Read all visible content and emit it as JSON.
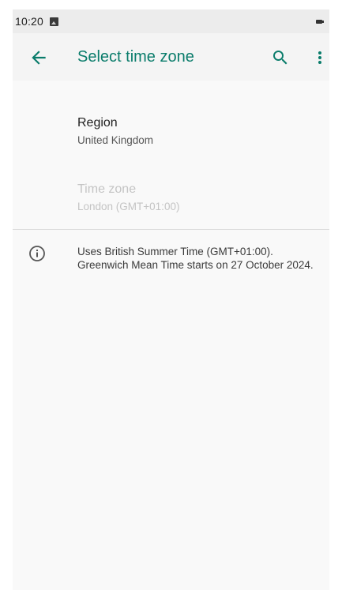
{
  "status_bar": {
    "time": "10:20",
    "icons": [
      "image-icon",
      "battery-icon"
    ]
  },
  "app_bar": {
    "title": "Select time zone",
    "accent_color": "#0a7c6b",
    "actions": [
      "back-arrow-icon",
      "search-icon",
      "more-vert-icon"
    ]
  },
  "settings": {
    "region": {
      "label": "Region",
      "value": "United Kingdom"
    },
    "time_zone": {
      "label": "Time zone",
      "value": "London (GMT+01:00)",
      "enabled": false
    }
  },
  "info": {
    "icon": "info-icon",
    "text": "Uses British Summer Time (GMT+01:00). Greenwich Mean Time starts on 27 October 2024."
  }
}
